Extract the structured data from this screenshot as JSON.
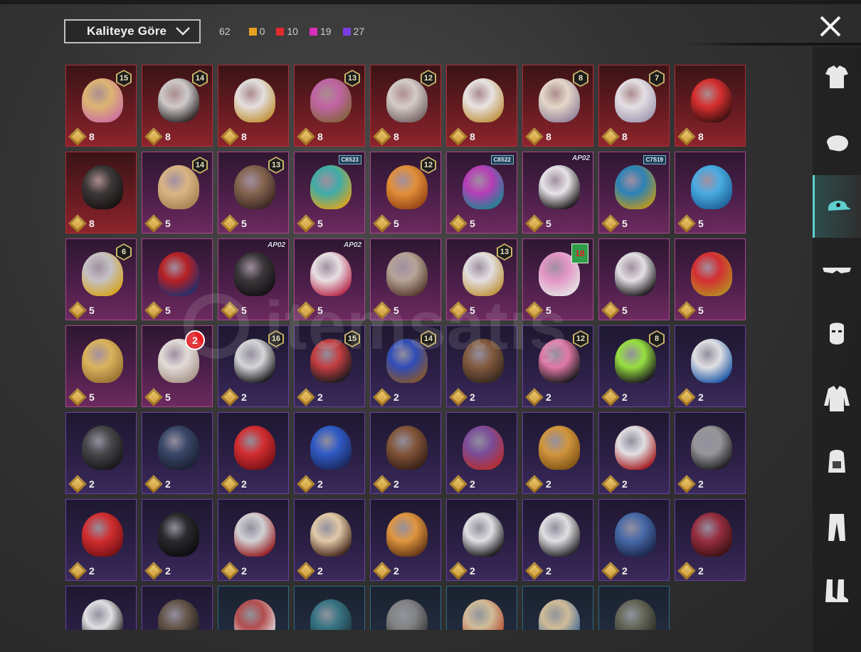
{
  "header": {
    "sort_label": "Kaliteye Göre",
    "total_count": "62",
    "rarity_counts": [
      {
        "color": "#e8a020",
        "count": "0"
      },
      {
        "color": "#e42b2b",
        "count": "10"
      },
      {
        "color": "#d62fb8",
        "count": "19"
      },
      {
        "color": "#7a3de0",
        "count": "27"
      }
    ]
  },
  "watermark": {
    "text": "itemsatış"
  },
  "sidebar": {
    "categories": [
      {
        "icon": "outfit-icon"
      },
      {
        "icon": "face-icon"
      },
      {
        "icon": "cap-icon",
        "active": true
      },
      {
        "icon": "glasses-icon"
      },
      {
        "icon": "mask-icon"
      },
      {
        "icon": "jacket-icon"
      },
      {
        "icon": "backpack-icon"
      },
      {
        "icon": "pants-icon"
      },
      {
        "icon": "boots-icon"
      }
    ]
  },
  "items": [
    {
      "rarity": "red",
      "badge": {
        "type": "level",
        "text": "15"
      },
      "value": "8",
      "name": "blonde-pink-hair-icon",
      "c1": "#e8c27a",
      "c2": "#d47aa8"
    },
    {
      "rarity": "red",
      "badge": {
        "type": "level",
        "text": "14"
      },
      "value": "8",
      "name": "masked-white-hair-icon",
      "c1": "#d9d9d9",
      "c2": "#2b2b2b"
    },
    {
      "rarity": "red",
      "badge": null,
      "value": "8",
      "name": "horned-white-hair-icon",
      "c1": "#f0f0f0",
      "c2": "#c9a040"
    },
    {
      "rarity": "red",
      "badge": {
        "type": "level",
        "text": "13"
      },
      "value": "8",
      "name": "pink-bow-hat-icon",
      "c1": "#c96ab0",
      "c2": "#8a6a45"
    },
    {
      "rarity": "red",
      "badge": {
        "type": "level",
        "text": "12"
      },
      "value": "8",
      "name": "silver-hair-icon",
      "c1": "#e0dcd5",
      "c2": "#7a7070"
    },
    {
      "rarity": "red",
      "badge": null,
      "value": "8",
      "name": "white-cowboy-hat-icon",
      "c1": "#f5f5f5",
      "c2": "#c7a14a"
    },
    {
      "rarity": "red",
      "badge": {
        "type": "level",
        "text": "8"
      },
      "value": "8",
      "name": "platinum-hair-icon",
      "c1": "#f1e7d6",
      "c2": "#9a8fa8"
    },
    {
      "rarity": "red",
      "badge": {
        "type": "level",
        "text": "7"
      },
      "value": "8",
      "name": "white-ponytail-icon",
      "c1": "#f0f0f5",
      "c2": "#a8a8c0"
    },
    {
      "rarity": "red",
      "badge": null,
      "value": "8",
      "name": "red-helmet-icon",
      "c1": "#e03030",
      "c2": "#3a1010"
    },
    {
      "rarity": "red",
      "badge": null,
      "value": "8",
      "name": "pirate-hat-icon",
      "c1": "#3a3a3a",
      "c2": "#111111"
    },
    {
      "rarity": "pink",
      "badge": {
        "type": "level",
        "text": "14"
      },
      "value": "5",
      "name": "flower-hair-icon",
      "c1": "#e6c28a",
      "c2": "#b08a55"
    },
    {
      "rarity": "pink",
      "badge": {
        "type": "level",
        "text": "13"
      },
      "value": "5",
      "name": "goggles-hair-icon",
      "c1": "#8a6a50",
      "c2": "#3a2a20"
    },
    {
      "rarity": "pink",
      "badge": {
        "type": "tag",
        "text": "C8S23"
      },
      "value": "5",
      "name": "cat-headphones-icon",
      "c1": "#3fb8b0",
      "c2": "#e0b020"
    },
    {
      "rarity": "pink",
      "badge": {
        "type": "level",
        "text": "12"
      },
      "value": "5",
      "name": "orange-hair-icon",
      "c1": "#f09a3a",
      "c2": "#a04a10"
    },
    {
      "rarity": "pink",
      "badge": {
        "type": "tag",
        "text": "C8S22"
      },
      "value": "5",
      "name": "purple-teal-hair-icon",
      "c1": "#c040c0",
      "c2": "#208a9a"
    },
    {
      "rarity": "pink",
      "badge": {
        "type": "text",
        "text": "AP02"
      },
      "value": "5",
      "name": "panda-head-icon",
      "c1": "#f5f5f5",
      "c2": "#1a1a1a"
    },
    {
      "rarity": "pink",
      "badge": {
        "type": "tag",
        "text": "C7S19"
      },
      "value": "5",
      "name": "feather-headdress-icon",
      "c1": "#2a8ac0",
      "c2": "#c0a020"
    },
    {
      "rarity": "pink",
      "badge": null,
      "value": "5",
      "name": "blue-cap-icon",
      "c1": "#4ab8f0",
      "c2": "#1a6aa0"
    },
    {
      "rarity": "pink",
      "badge": {
        "type": "level",
        "text": "6"
      },
      "value": "5",
      "name": "silver-visor-helmet-icon",
      "c1": "#d0d0d0",
      "c2": "#e0b020"
    },
    {
      "rarity": "pink",
      "badge": null,
      "value": "5",
      "name": "red-blue-hair-bun-icon",
      "c1": "#c02020",
      "c2": "#203070"
    },
    {
      "rarity": "pink",
      "badge": {
        "type": "text",
        "text": "AP02"
      },
      "value": "5",
      "name": "black-cat-mask-icon",
      "c1": "#3a3a3a",
      "c2": "#0f0f0f"
    },
    {
      "rarity": "pink",
      "badge": {
        "type": "text",
        "text": "AP02"
      },
      "value": "5",
      "name": "bunny-mask-icon",
      "c1": "#f5f0f0",
      "c2": "#c03050"
    },
    {
      "rarity": "pink",
      "badge": null,
      "value": "5",
      "name": "lace-ponytail-icon",
      "c1": "#c0b0a0",
      "c2": "#5a4030"
    },
    {
      "rarity": "pink",
      "badge": {
        "type": "level",
        "text": "13"
      },
      "value": "5",
      "name": "white-gold-helmet-icon",
      "c1": "#f0f0f0",
      "c2": "#c9a040"
    },
    {
      "rarity": "pink",
      "badge": {
        "type": "age",
        "text": "18"
      },
      "value": "5",
      "name": "pink-spiked-headphones-icon",
      "c1": "#f0a0d0",
      "c2": "#f0f0f0"
    },
    {
      "rarity": "pink",
      "badge": null,
      "value": "5",
      "name": "zebra-mask-icon",
      "c1": "#f0f0f0",
      "c2": "#1a1a1a"
    },
    {
      "rarity": "pink",
      "badge": null,
      "value": "5",
      "name": "red-dragon-mask-icon",
      "c1": "#e03030",
      "c2": "#c09020"
    },
    {
      "rarity": "pink",
      "badge": null,
      "value": "5",
      "name": "gold-cap-icon",
      "c1": "#e8c060",
      "c2": "#a07a30"
    },
    {
      "rarity": "pink",
      "badge": {
        "type": "red",
        "text": "2"
      },
      "value": "5",
      "name": "rabbit-mask-icon",
      "c1": "#f0ece5",
      "c2": "#b0a090"
    },
    {
      "rarity": "purple",
      "badge": {
        "type": "level",
        "text": "16"
      },
      "value": "2",
      "name": "white-spiky-goggles-hair-icon",
      "c1": "#e5e5e5",
      "c2": "#1a1a1a"
    },
    {
      "rarity": "purple",
      "badge": {
        "type": "level",
        "text": "15"
      },
      "value": "2",
      "name": "red-hair-beanie-icon",
      "c1": "#d04040",
      "c2": "#1a1a1a"
    },
    {
      "rarity": "purple",
      "badge": {
        "type": "level",
        "text": "14"
      },
      "value": "2",
      "name": "blue-cap-long-hair-icon",
      "c1": "#3050c0",
      "c2": "#8a5a30"
    },
    {
      "rarity": "purple",
      "badge": null,
      "value": "2",
      "name": "brown-bob-hair-icon",
      "c1": "#8a6040",
      "c2": "#3a2a1a"
    },
    {
      "rarity": "purple",
      "badge": {
        "type": "level",
        "text": "12"
      },
      "value": "2",
      "name": "bunny-ears-helmet-icon",
      "c1": "#f080b0",
      "c2": "#1a1a1a"
    },
    {
      "rarity": "purple",
      "badge": {
        "type": "level",
        "text": "8"
      },
      "value": "2",
      "name": "green-skull-mask-icon",
      "c1": "#a0f040",
      "c2": "#1a1a1a"
    },
    {
      "rarity": "purple",
      "badge": null,
      "value": "2",
      "name": "white-blue-cap-icon",
      "c1": "#f0f0f0",
      "c2": "#2060b0"
    },
    {
      "rarity": "purple",
      "badge": null,
      "value": "2",
      "name": "black-cap-icon",
      "c1": "#4a4a4a",
      "c2": "#151515"
    },
    {
      "rarity": "purple",
      "badge": null,
      "value": "2",
      "name": "navy-beanie-icon",
      "c1": "#3a4a6a",
      "c2": "#1a2030"
    },
    {
      "rarity": "purple",
      "badge": null,
      "value": "2",
      "name": "red-mohawk-icon",
      "c1": "#e03030",
      "c2": "#801010"
    },
    {
      "rarity": "purple",
      "badge": null,
      "value": "2",
      "name": "cricket-helmet-icon",
      "c1": "#3060d0",
      "c2": "#1a2a60"
    },
    {
      "rarity": "purple",
      "badge": null,
      "value": "2",
      "name": "brown-hair-clip-icon",
      "c1": "#8a5a3a",
      "c2": "#3a2010"
    },
    {
      "rarity": "purple",
      "badge": null,
      "value": "2",
      "name": "purple-witch-hat-icon",
      "c1": "#8050a0",
      "c2": "#c03030"
    },
    {
      "rarity": "purple",
      "badge": null,
      "value": "2",
      "name": "orange-beanie-icon",
      "c1": "#e0a040",
      "c2": "#8a5a10"
    },
    {
      "rarity": "purple",
      "badge": null,
      "value": "2",
      "name": "demon-mask-icon",
      "c1": "#f0f0f0",
      "c2": "#b02020"
    },
    {
      "rarity": "purple",
      "badge": null,
      "value": "2",
      "name": "wrestler-mask-icon",
      "c1": "#a0a0a0",
      "c2": "#202020"
    },
    {
      "rarity": "purple",
      "badge": null,
      "value": "2",
      "name": "red-beret-icon",
      "c1": "#e03030",
      "c2": "#801010"
    },
    {
      "rarity": "purple",
      "badge": null,
      "value": "2",
      "name": "black-bowler-hat-icon",
      "c1": "#2a2a2a",
      "c2": "#0a0a0a"
    },
    {
      "rarity": "purple",
      "badge": null,
      "value": "2",
      "name": "shark-hat-icon",
      "c1": "#e0e0e0",
      "c2": "#a02020"
    },
    {
      "rarity": "purple",
      "badge": null,
      "value": "2",
      "name": "cake-hat-icon",
      "c1": "#f0d8b0",
      "c2": "#4a2a1a"
    },
    {
      "rarity": "purple",
      "badge": null,
      "value": "2",
      "name": "burger-hat-icon",
      "c1": "#f0a040",
      "c2": "#6a3a10"
    },
    {
      "rarity": "purple",
      "badge": null,
      "value": "2",
      "name": "headlamp-icon",
      "c1": "#f0f0f0",
      "c2": "#1a1a1a"
    },
    {
      "rarity": "purple",
      "badge": null,
      "value": "2",
      "name": "captain-hat-icon",
      "c1": "#f0f0f0",
      "c2": "#2a2a2a"
    },
    {
      "rarity": "purple",
      "badge": null,
      "value": "2",
      "name": "blue-sailor-cap-icon",
      "c1": "#4a70b0",
      "c2": "#1a2a50"
    },
    {
      "rarity": "purple",
      "badge": null,
      "value": "2",
      "name": "maroon-fedora-icon",
      "c1": "#a03040",
      "c2": "#401010"
    },
    {
      "rarity": "purple",
      "badge": null,
      "value": "",
      "name": "bandana-icon",
      "c1": "#f0f0f0",
      "c2": "#1a1a1a"
    },
    {
      "rarity": "purple",
      "badge": null,
      "value": "",
      "name": "aviator-helmet-icon",
      "c1": "#6a5a4a",
      "c2": "#1a1a1a"
    },
    {
      "rarity": "blue",
      "badge": null,
      "value": "",
      "name": "striped-cap-icon",
      "c1": "#c05050",
      "c2": "#f0f0f0"
    },
    {
      "rarity": "blue",
      "badge": null,
      "value": "",
      "name": "teal-beret-icon",
      "c1": "#3a7a8a",
      "c2": "#1a3a40"
    },
    {
      "rarity": "blue",
      "badge": null,
      "value": "",
      "name": "grey-beret-icon",
      "c1": "#8a8a8a",
      "c2": "#3a3a3a"
    },
    {
      "rarity": "blue",
      "badge": null,
      "value": "",
      "name": "trucker-cap-icon",
      "c1": "#e0c8a0",
      "c2": "#c05030"
    },
    {
      "rarity": "blue",
      "badge": null,
      "value": "",
      "name": "baseball-cap-icon",
      "c1": "#e0c8a0",
      "c2": "#3a6aa0"
    },
    {
      "rarity": "blue",
      "badge": null,
      "value": "",
      "name": "camo-cap-icon",
      "c1": "#6a6a5a",
      "c2": "#2a2a20"
    }
  ]
}
